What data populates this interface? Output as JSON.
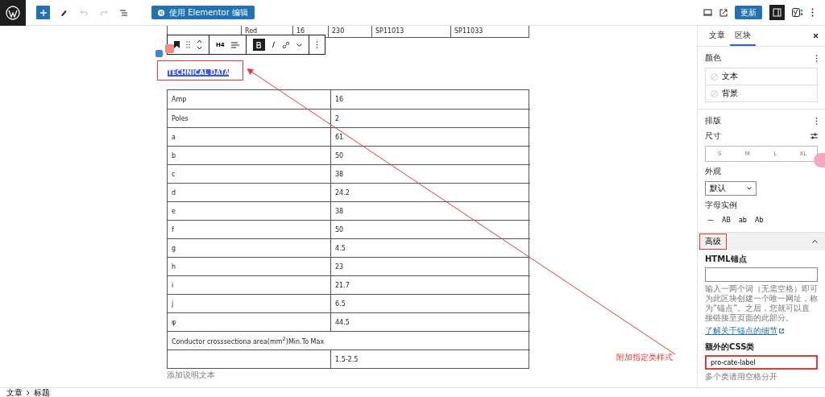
{
  "top_bar": {
    "tools": [
      {
        "kind": "add",
        "disabled": false
      },
      {
        "kind": "pen",
        "disabled": false
      },
      {
        "kind": "undo",
        "disabled": true
      },
      {
        "kind": "redo",
        "disabled": true
      },
      {
        "kind": "list",
        "disabled": false
      }
    ],
    "editor_button": "使用 Elementor 编辑",
    "update_button": "更新",
    "sidebar_toggle": {
      "pressed": true
    }
  },
  "canvas": {
    "top_table_row": [
      "Red",
      "16",
      "230",
      "SP11013",
      "SP11033"
    ],
    "block_toolbar": {
      "heading_level": "H4"
    },
    "heading": {
      "text": "TECHNICAL DATA",
      "highlighted": true
    },
    "table": {
      "rows": [
        {
          "kind": "pair",
          "label": "Amp",
          "value": "16"
        },
        {
          "kind": "pair",
          "label": "Poles",
          "value": "2"
        },
        {
          "kind": "pair",
          "label": "a",
          "value": "61"
        },
        {
          "kind": "pair",
          "label": "b",
          "value": "50"
        },
        {
          "kind": "pair",
          "label": "c",
          "value": "38"
        },
        {
          "kind": "pair",
          "label": "d",
          "value": "24.2"
        },
        {
          "kind": "pair",
          "label": "e",
          "value": "38"
        },
        {
          "kind": "pair",
          "label": "f",
          "value": "50"
        },
        {
          "kind": "pair",
          "label": "g",
          "value": "4.5"
        },
        {
          "kind": "pair",
          "label": "h",
          "value": "23"
        },
        {
          "kind": "pair",
          "label": "i",
          "value": "21.7"
        },
        {
          "kind": "pair",
          "label": "j",
          "value": "6.5"
        },
        {
          "kind": "pair",
          "label": "φ",
          "value": "44.5"
        },
        {
          "kind": "span",
          "label": "Conductor crosssectiona area(mm$^{2}$)Min.To Max"
        },
        {
          "kind": "value",
          "value": "1.5-2.5"
        }
      ],
      "caption": "添加说明文本"
    }
  },
  "annotation": {
    "text": "附加指定类样式"
  },
  "sidebar": {
    "tabs": [
      {
        "label": "文章",
        "selected": false
      },
      {
        "label": "区块",
        "selected": true
      }
    ],
    "color": {
      "title": "颜色",
      "items": [
        "文本",
        "背景"
      ]
    },
    "typography": {
      "title": "排版",
      "size_label": "尺寸",
      "sizes": [
        {
          "label": "S",
          "selected": false
        },
        {
          "label": "M",
          "selected": false
        },
        {
          "label": "L",
          "selected": false
        },
        {
          "label": "XL",
          "selected": false
        }
      ],
      "appearance_label": "外观",
      "appearance_value": "默认",
      "case_label": "字母实例",
      "cases": [
        "—",
        "AB",
        "ab",
        "Ab"
      ]
    },
    "advanced": {
      "title": "高级",
      "title_highlighted": true,
      "expanded": true,
      "anchor_label": "HTML锚点",
      "anchor_help": "输入一两个词（无需空格）即可为此区块创建一个唯一网址，称为“锚点”。之后，您就可以直接链接至页面的此部分。",
      "anchor_link": "了解关于锚点的细节",
      "css_label": "额外的CSS类",
      "css_value": "pro-cate-label",
      "css_highlighted": true,
      "css_hint": "多个类请用空格分开"
    }
  },
  "breadcrumb": [
    "文章",
    "标题"
  ]
}
